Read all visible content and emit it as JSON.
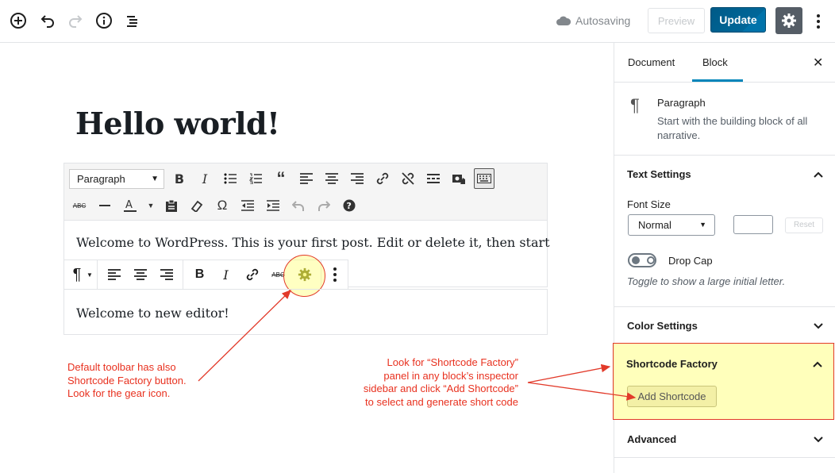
{
  "topbar": {
    "autosave_label": "Autosaving",
    "preview_label": "Preview",
    "update_label": "Update",
    "icons": [
      "add-block-icon",
      "undo-icon",
      "redo-icon",
      "info-icon",
      "outline-icon",
      "cloud-icon",
      "gear-icon",
      "more-vertical-icon"
    ]
  },
  "editor": {
    "title": "Hello world!",
    "classic": {
      "format_select": "Paragraph",
      "text": "Welcome to WordPress. This is your first post. Edit or delete it, then start"
    },
    "paragraph2_text": "Welcome to new editor!",
    "annotation_left": [
      "Default toolbar has also",
      "Shortcode Factory button.",
      "Look for the gear icon."
    ],
    "annotation_right": [
      "Look for “Shortcode Factory”",
      "panel in any block’s inspector",
      "sidebar and click “Add Shortcode”",
      "to select and generate short code"
    ],
    "highlight_color": "#e23a2a"
  },
  "sidebar": {
    "tab_document": "Document",
    "tab_block": "Block",
    "close_symbol": "✕",
    "block_card": {
      "title": "Paragraph",
      "description": "Start with the building block of all narrative."
    },
    "text_settings": {
      "title": "Text Settings",
      "font_size_label": "Font Size",
      "font_size_value": "Normal",
      "reset_label": "Reset",
      "drop_cap_label": "Drop Cap",
      "drop_cap_help": "Toggle to show a large initial letter."
    },
    "color_settings_title": "Color Settings",
    "shortcode_factory": {
      "title": "Shortcode Factory",
      "button_label": "Add Shortcode"
    },
    "advanced_title": "Advanced"
  },
  "colors": {
    "primary": "#0085ba",
    "update_button": "#006799",
    "highlight_fill": "#ffff96"
  }
}
